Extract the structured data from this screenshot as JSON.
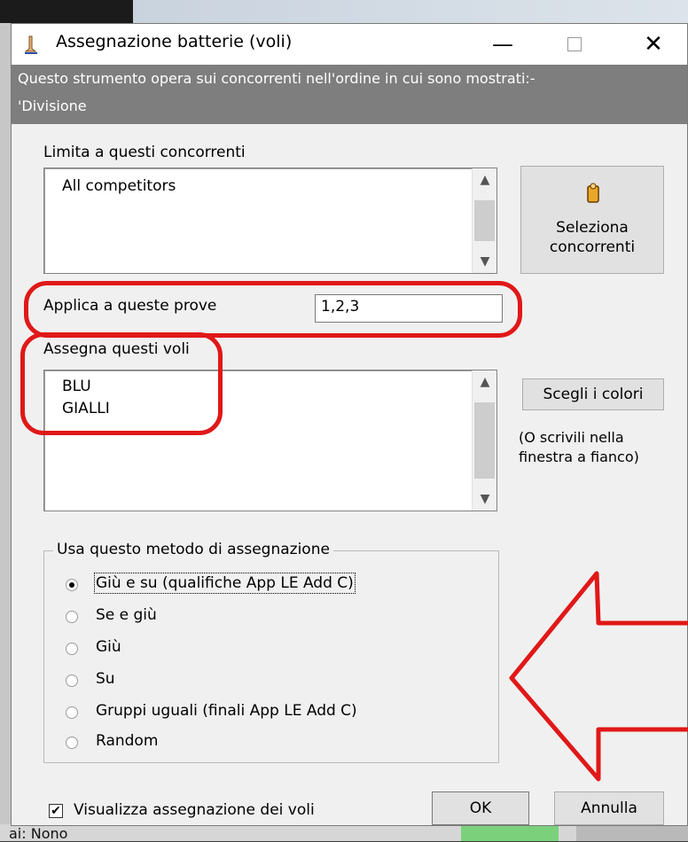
{
  "window": {
    "title": "Assegnazione batterie (voli)",
    "minimize_glyph": "—",
    "close_glyph": "✕"
  },
  "info": {
    "line1": "Questo strumento opera sui concorrenti nell'ordine in cui sono mostrati:-",
    "line2": "'Divisione"
  },
  "competitors": {
    "label": "Limita a questi concorrenti",
    "items": [
      "All competitors"
    ],
    "select_button": "Seleziona concorrenti"
  },
  "rounds": {
    "label": "Applica a queste prove",
    "value": "1,2,3"
  },
  "flights": {
    "label": "Assegna questi voli",
    "items": [
      "BLU",
      "GIALLI"
    ],
    "colors_button": "Scegli i colori",
    "hint": "(O scrivili nella finestra a fianco)"
  },
  "method": {
    "legend": "Usa questo metodo di assegnazione",
    "options": [
      "Giù e su (qualifiche App LE Add C)",
      "Se e giù",
      "Giù",
      "Su",
      "Gruppi uguali (finali App LE Add C)",
      "Random"
    ],
    "selected": 0
  },
  "footer": {
    "show_checkbox_label": "Visualizza assegnazione dei voli",
    "show_checked": true,
    "ok": "OK",
    "cancel": "Annulla"
  },
  "background": {
    "status_text": "ai: Nono"
  },
  "colors": {
    "annotation_red": "#e01818",
    "info_bar": "#7e7e7e"
  },
  "icons": [
    "app-icon",
    "minimize-icon",
    "maximize-icon",
    "close-icon",
    "select-competitors-icon",
    "scroll-up-icon",
    "scroll-down-icon",
    "red-arrow-annotation"
  ]
}
